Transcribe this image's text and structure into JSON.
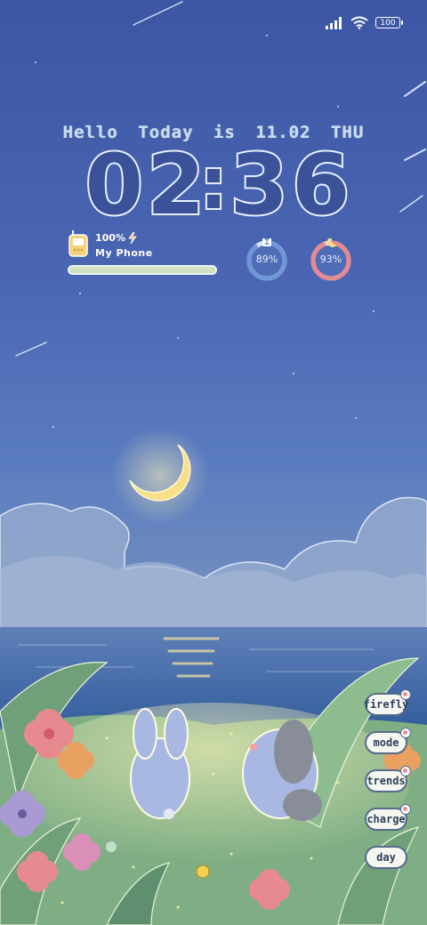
{
  "status_bar": {
    "signal_icon": "signal-bars-icon",
    "wifi_icon": "wifi-icon",
    "battery_level": "100"
  },
  "greeting": {
    "words": [
      "Hello",
      "Today",
      "is",
      "11.02",
      "THU"
    ]
  },
  "clock": {
    "hours": "02",
    "separator": ":",
    "minutes": "36"
  },
  "phone_widget": {
    "battery_percent": "100%",
    "charging_icon": "lightning-bolt-icon",
    "device_name": "My Phone",
    "battery_fraction": 1.0
  },
  "rings": [
    {
      "label": "89%",
      "value": 0.89,
      "icon": "hourglass-icon",
      "color": "#6f98d9"
    },
    {
      "label": "93%",
      "value": 0.93,
      "icon": "crescent-moon-icon",
      "color": "#e48a93"
    }
  ],
  "side_buttons": [
    {
      "label": "firefly"
    },
    {
      "label": "mode"
    },
    {
      "label": "trends"
    },
    {
      "label": "charge"
    },
    {
      "label": "day"
    }
  ],
  "colors": {
    "sky_top": "#3d56a4",
    "clock_fill": "#3b5298",
    "clock_outline": "#e8f0fb",
    "moon": "#f7df8a"
  }
}
